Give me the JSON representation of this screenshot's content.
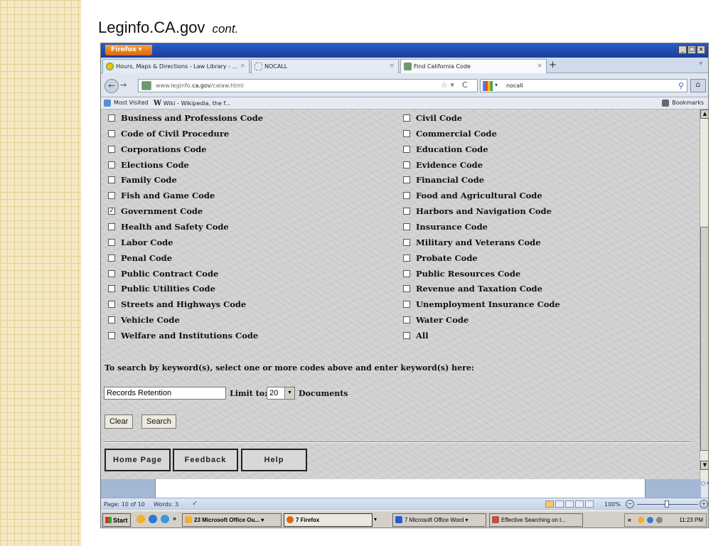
{
  "slide": {
    "title": "Leginfo.CA.gov",
    "title_cont": "cont."
  },
  "browser": {
    "app_button": "Firefox ▾",
    "window_controls": [
      "_",
      "□",
      "×"
    ],
    "tabs": [
      {
        "label": "Hours, Maps & Directions - Law Library - ...",
        "close": "×",
        "active": false
      },
      {
        "label": "NOCALL",
        "close": "×",
        "active": false
      },
      {
        "label": "Find California Code",
        "close": "×",
        "active": true
      }
    ],
    "new_tab": "+",
    "tab_list": "▾",
    "back": "←",
    "forward": "→",
    "url_prefix": "www.leginfo.",
    "url_domain": "ca.gov",
    "url_path": "/calaw.html",
    "star": "☆ ▾",
    "reload": "C",
    "search_engine": "▾",
    "search_value": "nocall",
    "search_icon": "⚲",
    "home": "⌂",
    "bookmarks_bar": {
      "most_visited": "Most Visited",
      "wiki_icon": "W",
      "wiki": "Wiki - Wikipedia, the f...",
      "bookmarks": "Bookmarks"
    }
  },
  "page": {
    "codes_left": [
      {
        "label": "Business and Professions Code",
        "checked": false
      },
      {
        "label": "Code of Civil Procedure",
        "checked": false
      },
      {
        "label": "Corporations Code",
        "checked": false
      },
      {
        "label": "Elections Code",
        "checked": false
      },
      {
        "label": "Family Code",
        "checked": false
      },
      {
        "label": "Fish and Game Code",
        "checked": false
      },
      {
        "label": "Government Code",
        "checked": true
      },
      {
        "label": "Health and Safety Code",
        "checked": false
      },
      {
        "label": "Labor Code",
        "checked": false
      },
      {
        "label": "Penal Code",
        "checked": false
      },
      {
        "label": "Public Contract Code",
        "checked": false
      },
      {
        "label": "Public Utilities Code",
        "checked": false
      },
      {
        "label": "Streets and Highways Code",
        "checked": false
      },
      {
        "label": "Vehicle Code",
        "checked": false
      },
      {
        "label": "Welfare and Institutions Code",
        "checked": false
      }
    ],
    "codes_right": [
      {
        "label": "Civil Code",
        "checked": false
      },
      {
        "label": "Commercial Code",
        "checked": false
      },
      {
        "label": "Education Code",
        "checked": false
      },
      {
        "label": "Evidence Code",
        "checked": false
      },
      {
        "label": "Financial Code",
        "checked": false
      },
      {
        "label": "Food and Agricultural Code",
        "checked": false
      },
      {
        "label": "Harbors and Navigation Code",
        "checked": false
      },
      {
        "label": "Insurance Code",
        "checked": false
      },
      {
        "label": "Military and Veterans Code",
        "checked": false
      },
      {
        "label": "Probate Code",
        "checked": false
      },
      {
        "label": "Public Resources Code",
        "checked": false
      },
      {
        "label": "Revenue and Taxation Code",
        "checked": false
      },
      {
        "label": "Unemployment Insurance Code",
        "checked": false
      },
      {
        "label": "Water Code",
        "checked": false
      },
      {
        "label": "All",
        "checked": false
      }
    ],
    "keyword_prompt": "To search by keyword(s), select one or more codes above and enter keyword(s) here:",
    "keyword_value": "Records Retention",
    "limit_label": "Limit to:",
    "limit_value": "20",
    "documents_label": "Documents",
    "clear_label": "Clear",
    "search_label": "Search",
    "home_page_label": "Home Page",
    "feedback_label": "Feedback",
    "help_label": "Help"
  },
  "word_status": {
    "page": "Page: 10 of 10",
    "words": "Words: 3",
    "proof_icon": "✓",
    "zoom": "100%",
    "zoom_out": "−",
    "zoom_in": "+",
    "scroll_marks": "○ ▾"
  },
  "taskbar": {
    "start": "Start",
    "more": "»",
    "buttons": [
      {
        "label": "23 Microsoft Office Ou... ▾",
        "pressed": false,
        "icon_color": "#f0b030"
      },
      {
        "label": "7 Firefox",
        "pressed": true,
        "icon_color": "#e0660c"
      },
      {
        "label": "▾",
        "pressed": false,
        "icon_color": ""
      },
      {
        "label": "7 Microsoft Office Word ▾",
        "pressed": false,
        "icon_color": "#2a5cc8"
      },
      {
        "label": "Effective Searching on t...",
        "pressed": false,
        "icon_color": "#c0504d"
      }
    ],
    "tray_chevron": "«",
    "clock": "11:23 PM"
  },
  "colors": {
    "title_bar": "#1a3e98",
    "page_background": "#d0d0d0",
    "accent_orange": "#e0660c"
  }
}
